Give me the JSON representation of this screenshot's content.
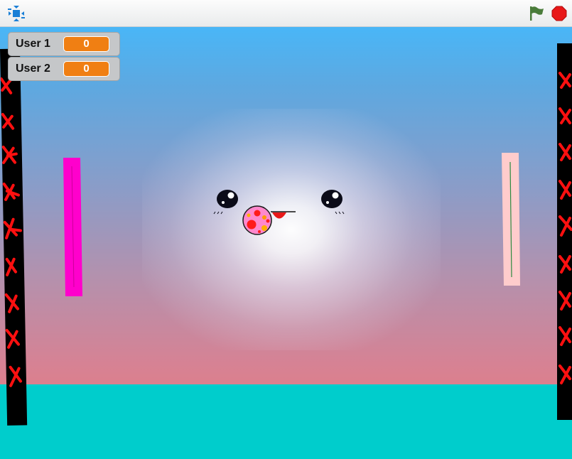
{
  "toolbar": {
    "fullscreen_icon": "fullscreen-toggle-icon",
    "green_flag_icon": "green-flag-icon",
    "stop_icon": "stop-sign-icon"
  },
  "monitors": [
    {
      "label": "User 1",
      "value": "0"
    },
    {
      "label": "User 2",
      "value": "0"
    }
  ],
  "colors": {
    "sky_top": "#49b6f7",
    "sky_bottom": "#ed7875",
    "ground": "#00cdcc",
    "monitor_value": "#f07f13",
    "left_paddle": "#ff00cc",
    "right_paddle": "#ffcccc",
    "wall": "#000000",
    "wall_marks": "#ff0000",
    "green_flag": "#4a7c3a",
    "stop": "#e81818",
    "fullscreen": "#1a7fd6"
  }
}
